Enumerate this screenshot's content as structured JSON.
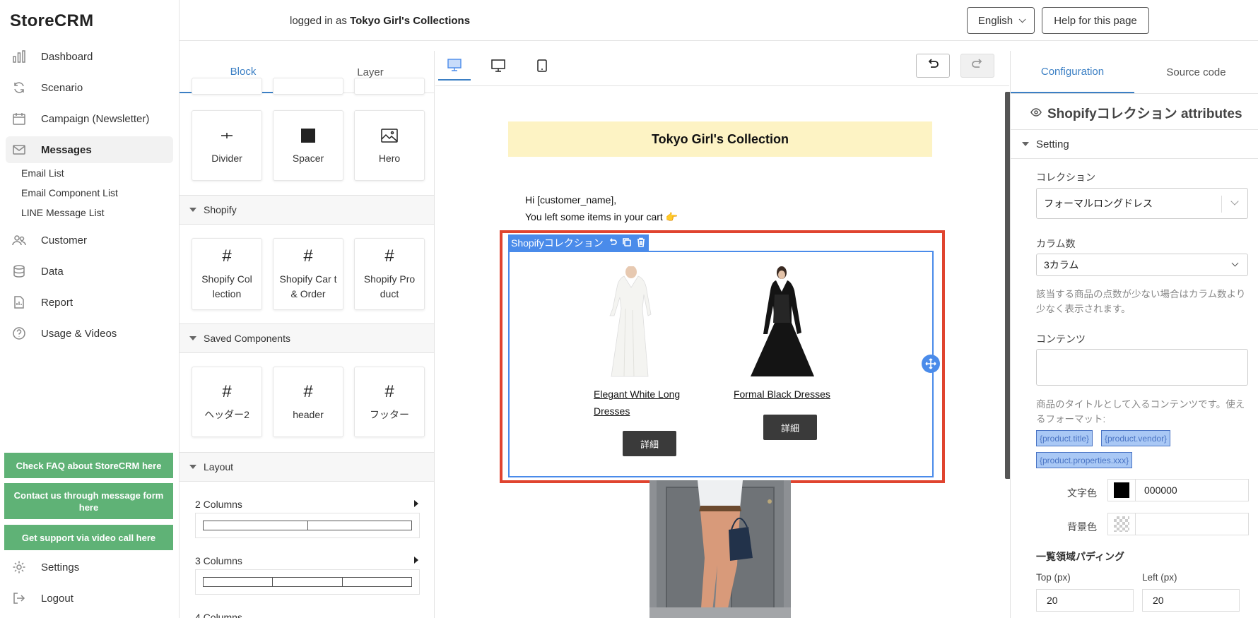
{
  "app": {
    "logo": "StoreCRM"
  },
  "header": {
    "logged_prefix": "logged in as ",
    "store_name": "Tokyo Girl's Collections",
    "language": "English",
    "help_label": "Help for this page"
  },
  "sidebar": {
    "items": [
      {
        "label": "Dashboard",
        "icon": "bar-chart-icon"
      },
      {
        "label": "Scenario",
        "icon": "refresh-icon"
      },
      {
        "label": "Campaign (Newsletter)",
        "icon": "calendar-icon"
      },
      {
        "label": "Messages",
        "icon": "mail-icon"
      },
      {
        "label": "Customer",
        "icon": "users-icon"
      },
      {
        "label": "Data",
        "icon": "database-icon"
      },
      {
        "label": "Report",
        "icon": "report-icon"
      },
      {
        "label": "Usage & Videos",
        "icon": "help-circle-icon"
      }
    ],
    "sub_items": [
      "Email List",
      "Email Component List",
      "LINE Message List"
    ],
    "support": [
      "Check FAQ about StoreCRM here",
      "Contact us through message form here",
      "Get support via video call here"
    ],
    "settings": "Settings",
    "logout": "Logout"
  },
  "block_panel": {
    "tabs": [
      "Block",
      "Layer"
    ],
    "basic_tiles": [
      {
        "label": "Divider",
        "icon": "divider-icon"
      },
      {
        "label": "Spacer",
        "icon": "spacer-icon"
      },
      {
        "label": "Hero",
        "icon": "image-icon"
      }
    ],
    "shopify_header": "Shopify",
    "shopify_tiles": [
      "Shopify Col lection",
      "Shopify Car t & Order",
      "Shopify Pro duct"
    ],
    "saved_header": "Saved Components",
    "saved_tiles": [
      "ヘッダー2",
      "header",
      "フッター"
    ],
    "layout_header": "Layout",
    "layouts": [
      "2 Columns",
      "3 Columns",
      "4 Columns"
    ]
  },
  "canvas": {
    "banner_title": "Tokyo Girl's Collection",
    "greeting": "Hi [customer_name],",
    "message": "You left some items in your cart 👉",
    "selected_block": "Shopifyコレクション",
    "products": [
      {
        "name": "Elegant White Long Dresses",
        "button": "詳細"
      },
      {
        "name": "Formal Black Dresses",
        "button": "詳細"
      }
    ]
  },
  "config": {
    "tabs": [
      "Configuration",
      "Source code"
    ],
    "title": "Shopifyコレクション attributes",
    "section": "Setting",
    "collection_label": "コレクション",
    "collection_value": "フォーマルロングドレス",
    "columns_label": "カラム数",
    "columns_value": "3カラム",
    "columns_help": "該当する商品の点数が少ない場合はカラム数より少なく表示されます。",
    "content_label": "コンテンツ",
    "content_help": "商品のタイトルとして入るコンテンツです。使えるフォーマット:",
    "chips": [
      "{product.title}",
      "{product.vendor}",
      "{product.properties.xxx}"
    ],
    "text_color_label": "文字色",
    "text_color_value": "000000",
    "bg_color_label": "背景色",
    "padding_label": "一覧領域パディング",
    "top_label": "Top (px)",
    "left_label": "Left (px)",
    "top_value": "20",
    "left_value": "20"
  },
  "colors": {
    "accent": "#3b7fc4",
    "support_green": "#5fb276",
    "selection_red": "#e0442f",
    "selection_blue": "#4a8bea",
    "banner_yellow": "#fdf3c4"
  }
}
